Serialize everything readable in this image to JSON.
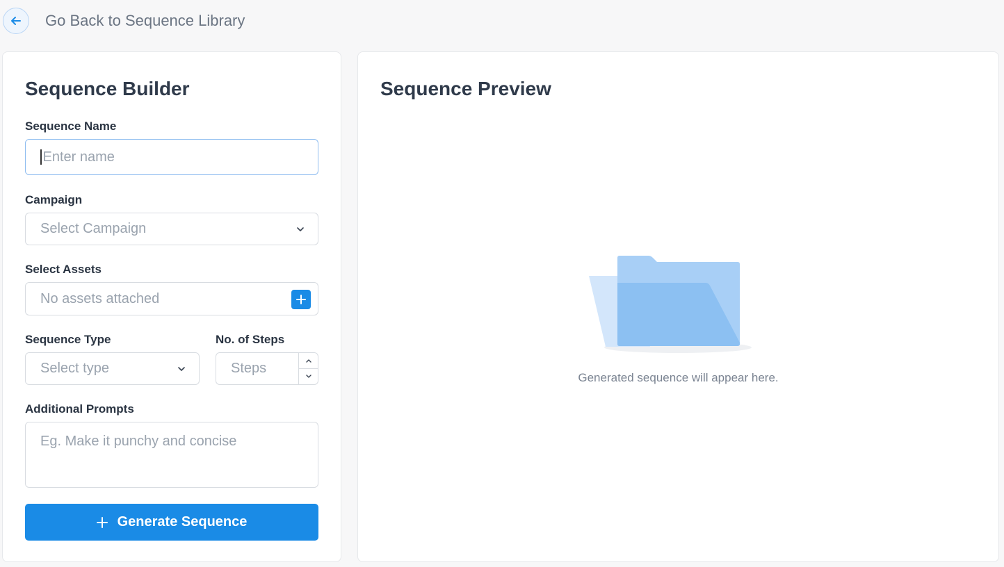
{
  "topbar": {
    "back_label": "Go Back to Sequence Library",
    "back_icon": "arrow-left-icon"
  },
  "builder": {
    "title": "Sequence Builder",
    "sequence_name": {
      "label": "Sequence Name",
      "placeholder": "Enter name",
      "value": ""
    },
    "campaign": {
      "label": "Campaign",
      "placeholder": "Select Campaign"
    },
    "assets": {
      "label": "Select Assets",
      "placeholder": "No assets attached",
      "add_icon": "plus-icon"
    },
    "sequence_type": {
      "label": "Sequence Type",
      "placeholder": "Select type"
    },
    "steps": {
      "label": "No. of Steps",
      "placeholder": "Steps"
    },
    "prompts": {
      "label": "Additional Prompts",
      "placeholder": "Eg. Make it punchy and concise"
    },
    "generate_label": "Generate Sequence"
  },
  "preview": {
    "title": "Sequence Preview",
    "empty_message": "Generated sequence will appear here.",
    "empty_icon": "folder-icon"
  },
  "colors": {
    "accent": "#1a8be6",
    "text": "#2f3a4a",
    "muted": "#9aa3ae"
  }
}
